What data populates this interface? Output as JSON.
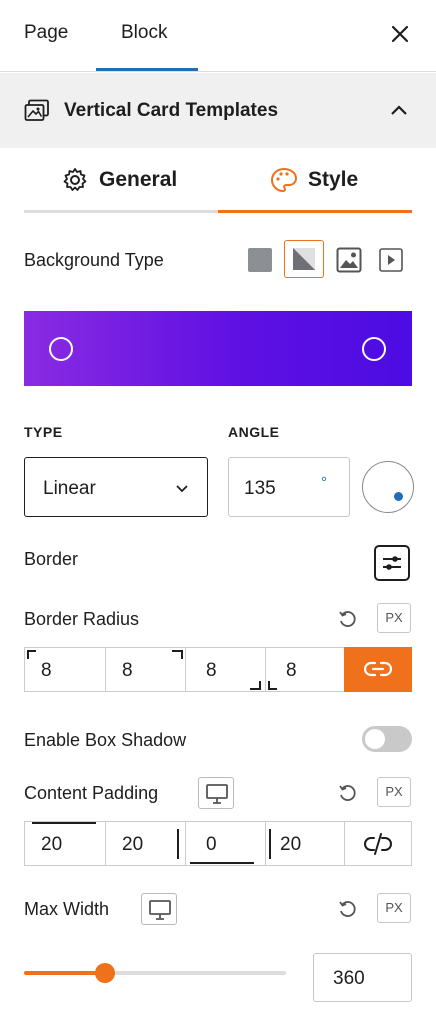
{
  "header": {
    "tabs": [
      {
        "label": "Page"
      },
      {
        "label": "Block"
      }
    ],
    "active_tab": "Block"
  },
  "panel": {
    "title": "Vertical Card Templates"
  },
  "inner_tabs": [
    {
      "label": "General"
    },
    {
      "label": "Style"
    }
  ],
  "active_inner_tab": "Style",
  "background": {
    "label": "Background Type",
    "types": [
      "color-icon",
      "gradient-icon",
      "image-icon",
      "video-icon"
    ],
    "selected": "gradient",
    "gradient_colors": [
      "#8a2be2",
      "#4c0ce3"
    ],
    "type_label": "TYPE",
    "type_value": "Linear",
    "angle_label": "ANGLE",
    "angle_value": "135",
    "angle_unit": "°"
  },
  "border": {
    "label": "Border"
  },
  "border_radius": {
    "label": "Border Radius",
    "unit": "PX",
    "values": [
      "8",
      "8",
      "8",
      "8"
    ],
    "linked": true
  },
  "box_shadow": {
    "label": "Enable Box Shadow",
    "enabled": false
  },
  "content_padding": {
    "label": "Content Padding",
    "unit": "PX",
    "values": [
      "20",
      "20",
      "0",
      "20"
    ],
    "linked": false
  },
  "max_width": {
    "label": "Max Width",
    "unit": "PX",
    "value": "360",
    "slider_fraction": 0.31
  },
  "colors": {
    "accent": "#f0711b",
    "blue": "#1e6fb3"
  }
}
